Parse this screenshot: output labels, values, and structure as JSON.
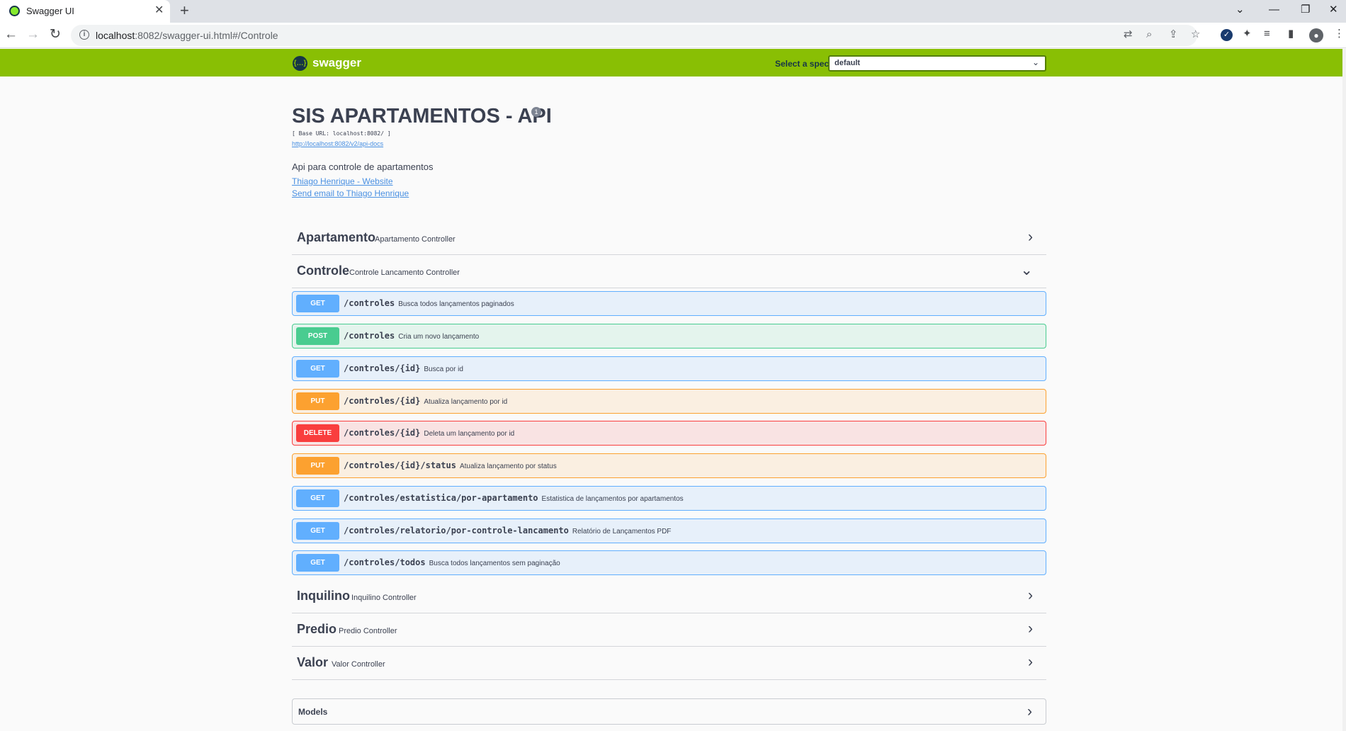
{
  "browser": {
    "tab_title": "Swagger UI",
    "tab_close": "✕",
    "new_tab": "+",
    "url_host": "localhost",
    "url_rest": ":8082/swagger-ui.html#/Controle",
    "controls": {
      "chevron": "⌄",
      "minimize": "—",
      "restore": "❐",
      "close": "✕"
    }
  },
  "topbar": {
    "logo_glyph": "{…}",
    "logo_text": "swagger",
    "select_label": "Select a spec",
    "select_value": "default"
  },
  "info": {
    "title": "SIS APARTAMENTOS - API",
    "base_url": "[ Base URL: localhost:8082/ ]",
    "docs_link": "http://localhost:8082/v2/api-docs",
    "description": "Api para controle de apartamentos",
    "website_link": "Thiago Henrique - Website",
    "email_link": "Send email to Thiago Henrique"
  },
  "tags": [
    {
      "name": "Apartamento",
      "description": "Apartamento Controller",
      "expanded": false
    },
    {
      "name": "Controle",
      "description": "Controle Lancamento Controller",
      "expanded": true
    },
    {
      "name": "Inquilino",
      "description": "Inquilino Controller",
      "expanded": false
    },
    {
      "name": "Predio",
      "description": "Predio Controller",
      "expanded": false
    },
    {
      "name": "Valor",
      "description": "Valor Controller",
      "expanded": false
    }
  ],
  "operations": [
    {
      "method": "GET",
      "path": "/controles",
      "summary": "Busca todos lançamentos paginados"
    },
    {
      "method": "POST",
      "path": "/controles",
      "summary": "Cria um novo lançamento"
    },
    {
      "method": "GET",
      "path": "/controles/{id}",
      "summary": "Busca por id"
    },
    {
      "method": "PUT",
      "path": "/controles/{id}",
      "summary": "Atualiza lançamento por id"
    },
    {
      "method": "DELETE",
      "path": "/controles/{id}",
      "summary": "Deleta um lançamento por id"
    },
    {
      "method": "PUT",
      "path": "/controles/{id}/status",
      "summary": "Atualiza lançamento por status"
    },
    {
      "method": "GET",
      "path": "/controles/estatistica/por-apartamento",
      "summary": "Estatistica de lançamentos por apartamentos"
    },
    {
      "method": "GET",
      "path": "/controles/relatorio/por-controle-lancamento",
      "summary": "Relatório de Lançamentos PDF"
    },
    {
      "method": "GET",
      "path": "/controles/todos",
      "summary": "Busca todos lançamentos sem paginação"
    }
  ],
  "models": {
    "title": "Models"
  },
  "colors": {
    "topbar": "#89bf04",
    "get": "#61affe",
    "post": "#49cc90",
    "put": "#fca130",
    "delete": "#f93e3e",
    "link": "#4990e2"
  }
}
